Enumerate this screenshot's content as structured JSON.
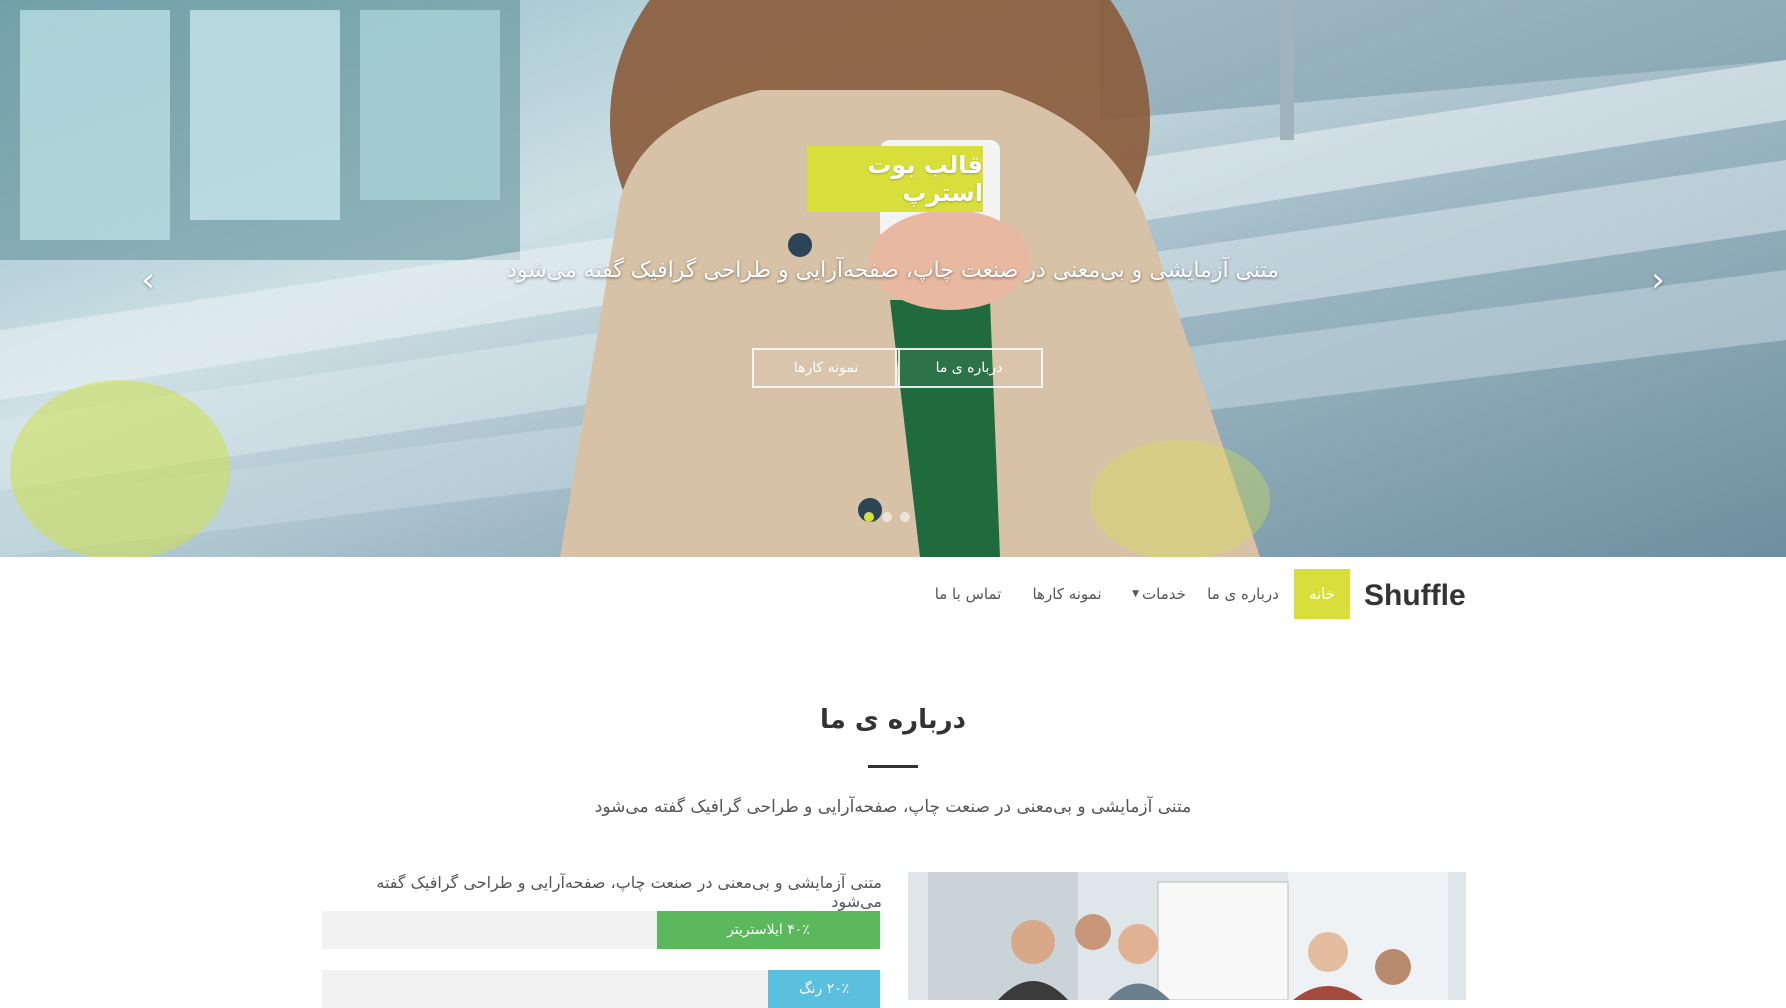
{
  "hero": {
    "title": "قالب بوت استرپ",
    "subtitle": "متنی آزمایشی و بی‌معنی در صنعت چاپ، صفحه‌آرایی و طراحی گرافیک گفته می‌شود",
    "button_about": "درباره ی ما",
    "button_works": "نمونه کارها",
    "prev_icon": "chevron-left-icon",
    "next_icon": "chevron-right-icon"
  },
  "navbar": {
    "brand": "Shuffle",
    "items": [
      {
        "label": "خانه",
        "active": true
      },
      {
        "label": "درباره ی ما"
      },
      {
        "label": "خدمات"
      },
      {
        "label": "نمونه کارها"
      },
      {
        "label": "تماس با ما"
      }
    ],
    "accent_color": "#d9df3a"
  },
  "about": {
    "title": "درباره ی ما",
    "lead": "متنی آزمایشی و بی‌معنی در صنعت چاپ، صفحه‌آرایی و طراحی گرافیک گفته می‌شود",
    "skills_intro": "متنی آزمایشی و بی‌معنی در صنعت چاپ، صفحه‌آرایی و طراحی گرافیک گفته می‌شود",
    "skills": [
      {
        "label": "۴۰٪ ایلاستریتر",
        "percent": 40,
        "color": "#5cb85c"
      },
      {
        "label": "۲۰٪ رنگ",
        "percent": 20,
        "color": "#5bc0de"
      }
    ]
  }
}
